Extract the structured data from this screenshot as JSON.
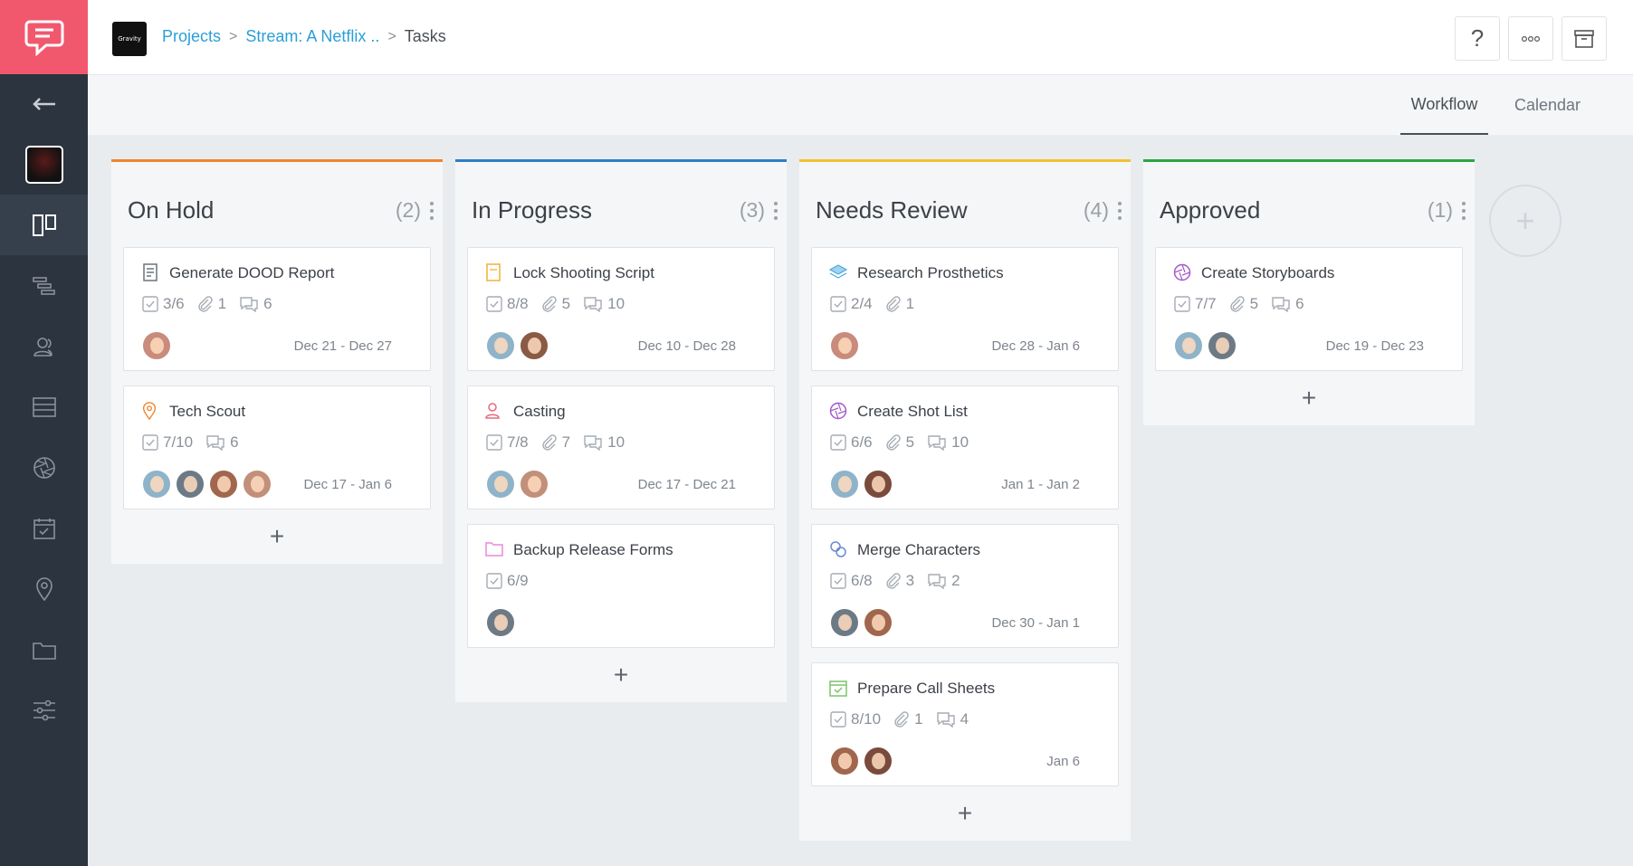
{
  "app": {
    "brand_logo_text": "Gravity"
  },
  "breadcrumb": {
    "items": [
      "Projects",
      "Stream: A Netflix ..",
      "Tasks"
    ]
  },
  "header_buttons": {
    "help": "?"
  },
  "tabs": [
    "Workflow",
    "Calendar"
  ],
  "active_tab": "Workflow",
  "colors": {
    "on_hold": "#f0842c",
    "in_progress": "#2d7fc4",
    "needs_review": "#f2c230",
    "approved": "#27a745",
    "sidebar": "#2c3440",
    "logo": "#f1586d",
    "link": "#2b9fd7"
  },
  "columns": [
    {
      "title": "On Hold",
      "count": "(2)",
      "color": "#f0842c",
      "add_label": "+",
      "cards": [
        {
          "icon": "report-icon",
          "title": "Generate DOOD Report",
          "checks": "3/6",
          "attachments": "1",
          "comments": "6",
          "date": "Dec 21 - Dec 27",
          "avatars": [
            "#c98b7c"
          ]
        },
        {
          "icon": "location-pin-icon",
          "title": "Tech Scout",
          "checks": "7/10",
          "attachments": "",
          "comments": "6",
          "date": "Dec 17 - Jan 6",
          "avatars": [
            "#8fb3c9",
            "#6c7a86",
            "#a0674e",
            "#c28f7b"
          ]
        }
      ]
    },
    {
      "title": "In Progress",
      "count": "(3)",
      "color": "#2d7fc4",
      "add_label": "+",
      "cards": [
        {
          "icon": "script-icon",
          "title": "Lock Shooting Script",
          "checks": "8/8",
          "attachments": "5",
          "comments": "10",
          "date": "Dec 10 - Dec 28",
          "avatars": [
            "#8fb3c9",
            "#8a5a44"
          ]
        },
        {
          "icon": "casting-icon",
          "title": "Casting",
          "checks": "7/8",
          "attachments": "7",
          "comments": "10",
          "date": "Dec 17 - Dec 21",
          "avatars": [
            "#8fb3c9",
            "#c28f7b"
          ]
        },
        {
          "icon": "folder-icon",
          "title": "Backup Release Forms",
          "checks": "6/9",
          "attachments": "",
          "comments": "",
          "date": "",
          "avatars": [
            "#6c7a86"
          ]
        }
      ]
    },
    {
      "title": "Needs Review",
      "count": "(4)",
      "color": "#f2c230",
      "add_label": "+",
      "cards": [
        {
          "icon": "layers-icon",
          "title": "Research Prosthetics",
          "checks": "2/4",
          "attachments": "1",
          "comments": "",
          "date": "Dec 28 - Jan 6",
          "avatars": [
            "#c98b7c"
          ]
        },
        {
          "icon": "aperture-icon",
          "title": "Create Shot List",
          "checks": "6/6",
          "attachments": "5",
          "comments": "10",
          "date": "Jan 1 - Jan 2",
          "avatars": [
            "#8fb3c9",
            "#7a4a3c"
          ]
        },
        {
          "icon": "merge-icon",
          "title": "Merge Characters",
          "checks": "6/8",
          "attachments": "3",
          "comments": "2",
          "date": "Dec 30 - Jan 1",
          "avatars": [
            "#6c7a86",
            "#a0674e"
          ]
        },
        {
          "icon": "calendar-check-icon",
          "title": "Prepare Call Sheets",
          "checks": "8/10",
          "attachments": "1",
          "comments": "4",
          "date": "Jan 6",
          "avatars": [
            "#a0674e",
            "#7a4a3c"
          ]
        }
      ]
    },
    {
      "title": "Approved",
      "count": "(1)",
      "color": "#27a745",
      "add_label": "+",
      "cards": [
        {
          "icon": "aperture-icon",
          "title": "Create Storyboards",
          "checks": "7/7",
          "attachments": "5",
          "comments": "6",
          "date": "Dec 19 - Dec 23",
          "avatars": [
            "#8fb3c9",
            "#6c7a86"
          ]
        }
      ]
    }
  ],
  "add_column_label": "+"
}
